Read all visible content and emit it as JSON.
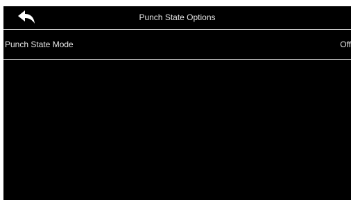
{
  "header": {
    "title": "Punch State Options",
    "back_icon": "back-arrow-icon"
  },
  "settings": [
    {
      "label": "Punch State Mode",
      "value": "Off"
    }
  ],
  "colors": {
    "background": "#000000",
    "text": "#e6e6e6",
    "divider": "#c8c8c8"
  }
}
